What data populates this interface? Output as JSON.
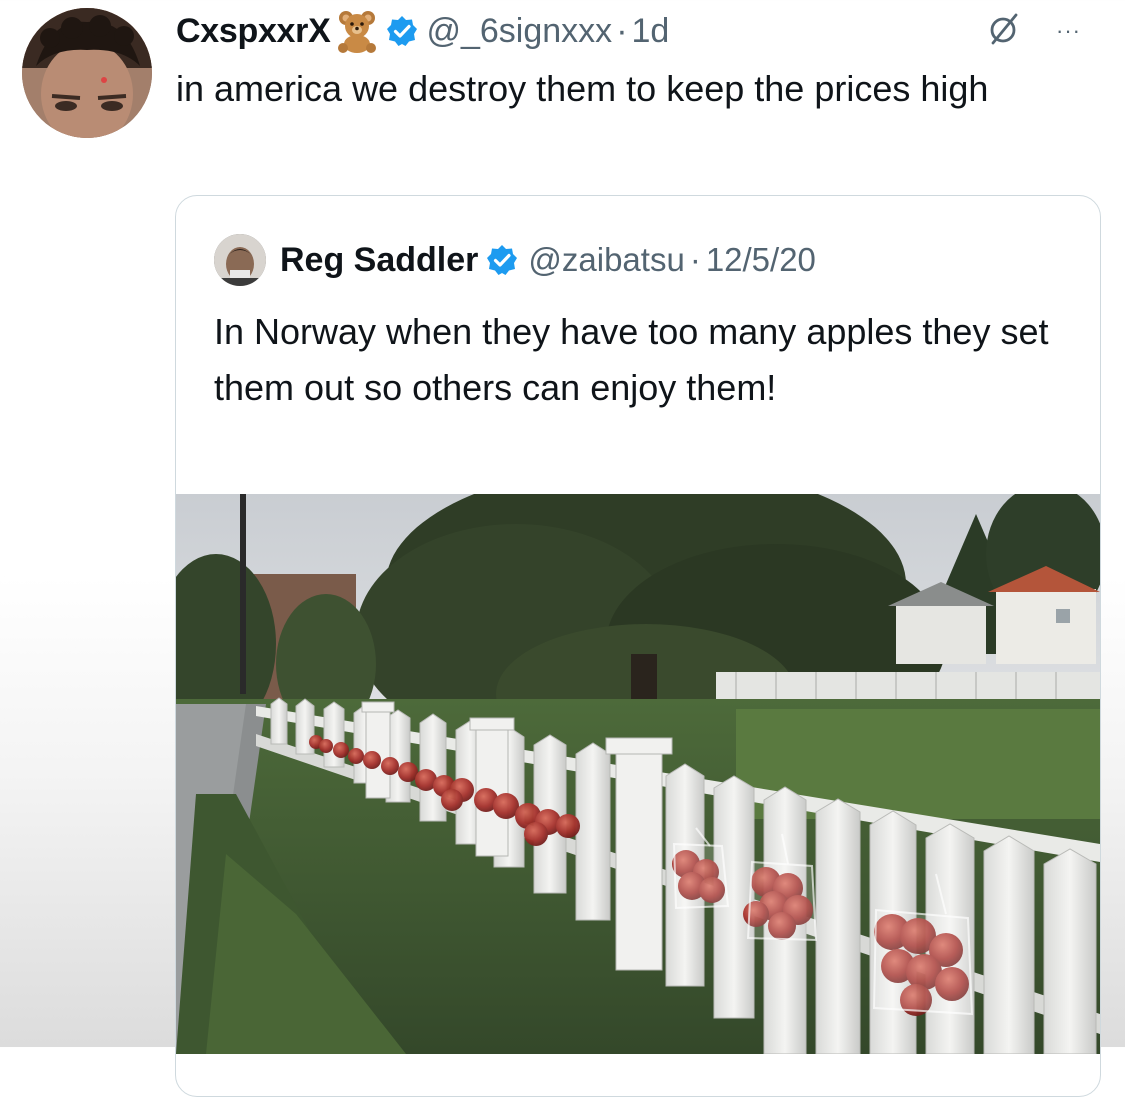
{
  "tweet": {
    "display_name": "CxspxxrX",
    "name_emoji": "teddy-bear",
    "verified": true,
    "handle": "@_6signxxx",
    "separator": "·",
    "time": "1d",
    "grok_icon": "slashed-circle-icon",
    "more_label": "···",
    "text": "in america we destroy them to keep the prices high"
  },
  "quoted": {
    "display_name": "Reg Saddler",
    "verified": true,
    "handle": "@zaibatsu",
    "separator": "·",
    "date": "12/5/20",
    "text": "In Norway when they have too many apples they set them out so others can enjoy them!"
  },
  "colors": {
    "text_primary": "#0f1419",
    "text_secondary": "#536471",
    "verified_blue": "#1d9bf0",
    "card_border": "#cfd9de"
  }
}
